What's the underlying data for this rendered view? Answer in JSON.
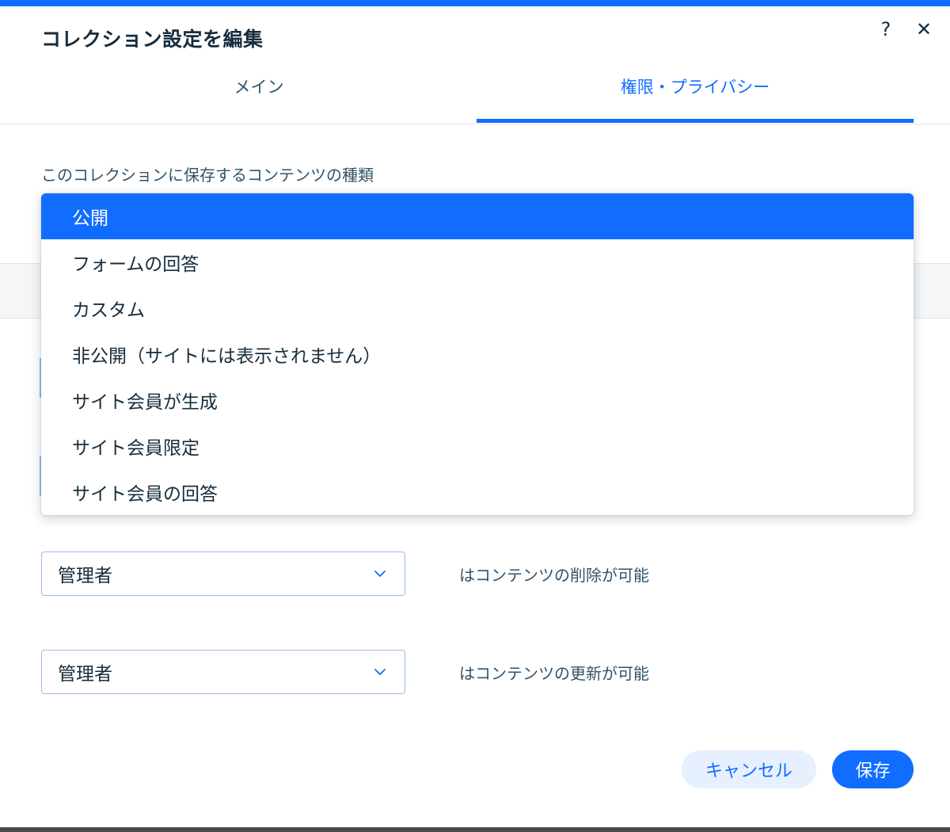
{
  "dialog": {
    "title": "コレクション設定を編集",
    "help_icon": "?",
    "close_icon": "✕"
  },
  "tabs": [
    {
      "label": "メイン",
      "active": false
    },
    {
      "label": "権限・プライバシー",
      "active": true
    }
  ],
  "content_type": {
    "label": "このコレクションに保存するコンテンツの種類",
    "selected": "公開",
    "options": [
      "公開",
      "フォームの回答",
      "カスタム",
      "非公開（サイトには表示されません）",
      "サイト会員が生成",
      "サイト会員限定",
      "サイト会員の回答"
    ]
  },
  "permissions": [
    {
      "role": "管理者",
      "description": "はコンテンツの削除が可能"
    },
    {
      "role": "管理者",
      "description": "はコンテンツの更新が可能"
    }
  ],
  "footer": {
    "cancel_label": "キャンセル",
    "save_label": "保存"
  },
  "colors": {
    "accent": "#116dff",
    "cancel_bg": "#e7f0ff",
    "text": "#162d3d"
  }
}
